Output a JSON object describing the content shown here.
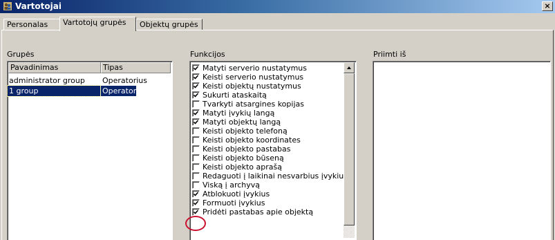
{
  "window": {
    "title": "Vartotojai",
    "close_glyph": "×",
    "icon": "users-icon"
  },
  "tabs": [
    {
      "label": "Personalas",
      "active": false
    },
    {
      "label": "Vartotojų grupės",
      "active": true
    },
    {
      "label": "Objektų grupės",
      "active": false
    }
  ],
  "groups": {
    "label": "Grupės",
    "columns": [
      "Pavadinimas",
      "Tipas"
    ],
    "rows": [
      {
        "name": "administrator group",
        "type": "Operatorius",
        "selected": false
      },
      {
        "name": "1 group",
        "type": "Operatorius",
        "selected": true
      }
    ]
  },
  "functions": {
    "label": "Funkcijos",
    "items": [
      {
        "label": "Matyti serverio nustatymus",
        "checked": true
      },
      {
        "label": "Keisti serverio nustatymus",
        "checked": true
      },
      {
        "label": "Keisti objektų nustatymus",
        "checked": true
      },
      {
        "label": "Sukurti ataskaitą",
        "checked": true
      },
      {
        "label": "Tvarkyti atsargines kopijas",
        "checked": false
      },
      {
        "label": "Matyti įvykių langą",
        "checked": true
      },
      {
        "label": "Matyti objektų langą",
        "checked": true
      },
      {
        "label": "Keisti objekto telefoną",
        "checked": false
      },
      {
        "label": "Keisti objekto koordinates",
        "checked": false
      },
      {
        "label": "Keisti objekto pastabas",
        "checked": false
      },
      {
        "label": "Keisti objekto būseną",
        "checked": false
      },
      {
        "label": "Keisti objekto aprašą",
        "checked": false
      },
      {
        "label": "Redaguoti į laikinai nesvarbius įvykius",
        "checked": false
      },
      {
        "label": "Viską į archyvą",
        "checked": false
      },
      {
        "label": "Atblokuoti įvykius",
        "checked": true
      },
      {
        "label": "Formuoti įvykius",
        "checked": true
      },
      {
        "label": "Pridėti pastabas apie objektą",
        "checked": true
      }
    ]
  },
  "accept_from": {
    "label": "Priimti iš"
  },
  "colors": {
    "selection": "#0a246a",
    "annotation_circle": "#c8102e",
    "face": "#d4d0c8"
  }
}
